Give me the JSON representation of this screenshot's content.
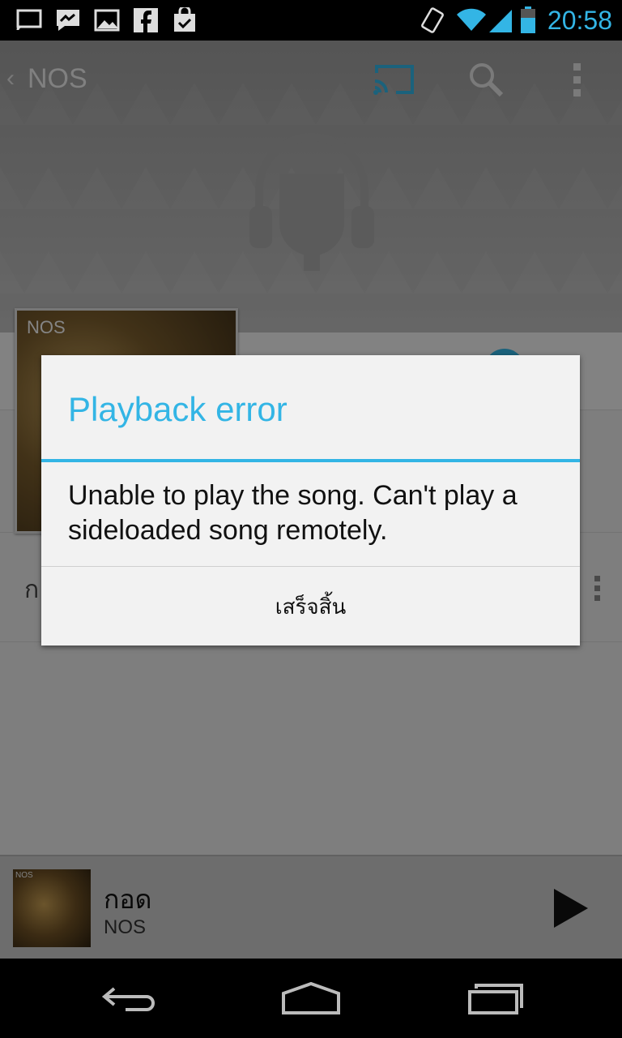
{
  "status_bar": {
    "time": "20:58",
    "accent": "#33b5e5",
    "icons": [
      "cast-icon",
      "messenger-icon",
      "gallery-icon",
      "facebook-icon",
      "shopping-bag-icon",
      "vibrate-icon",
      "wifi-icon",
      "signal-icon",
      "battery-icon"
    ]
  },
  "action_bar": {
    "title": "NOS",
    "icons": [
      "back-caret-icon",
      "cast-icon",
      "search-icon",
      "overflow-menu-icon"
    ]
  },
  "album": {
    "label": "NOS"
  },
  "list": {
    "first_row_initial": "ก"
  },
  "dialog": {
    "title": "Playback error",
    "message": "Unable to play the song. Can't play a sideloaded song remotely.",
    "button_label": "เสร็จสิ้น"
  },
  "now_playing": {
    "art_label": "NOS",
    "title": "กอด",
    "artist": "NOS",
    "play_icon": "play-icon"
  },
  "nav_bar": {
    "icons": [
      "back-icon",
      "home-icon",
      "recents-icon"
    ]
  }
}
